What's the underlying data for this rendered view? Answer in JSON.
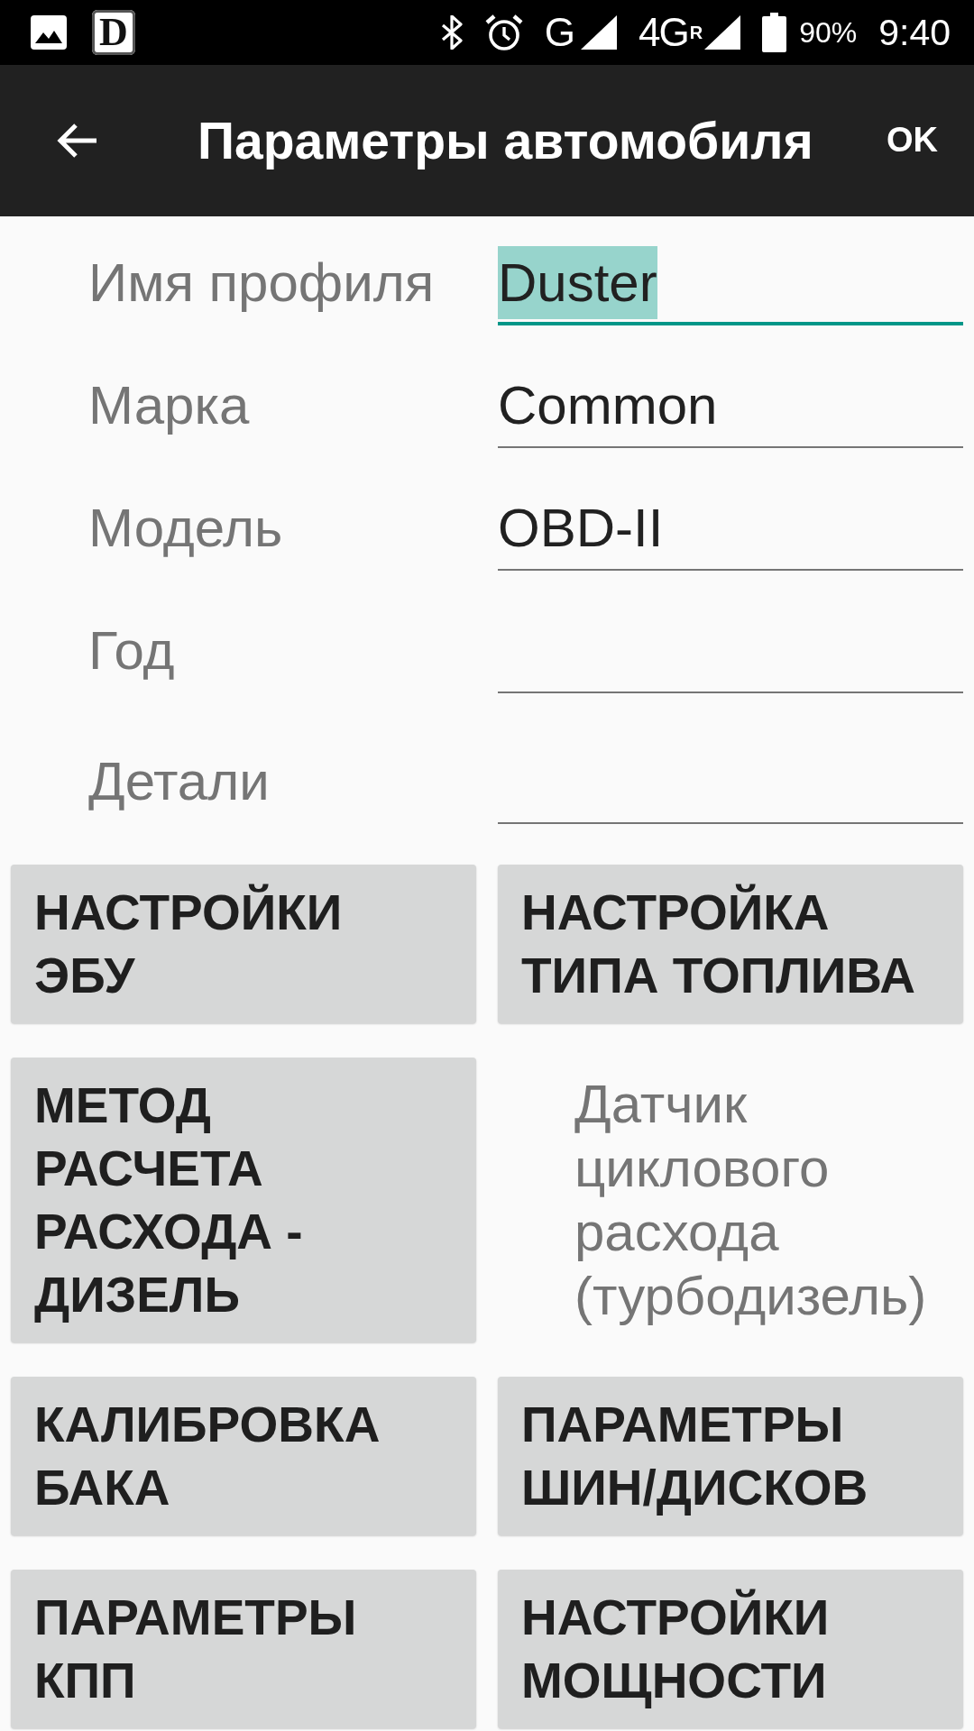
{
  "status_bar": {
    "notifications": [
      {
        "kind": "image"
      },
      {
        "kind": "letter",
        "text": "D"
      }
    ],
    "networks": [
      {
        "type": "G"
      },
      {
        "type": "4G",
        "roaming": "R"
      }
    ],
    "battery": "90%",
    "time": "9:40"
  },
  "app_bar": {
    "title": "Параметры автомобиля",
    "action": "OK"
  },
  "fields": [
    {
      "label": "Имя профиля",
      "value": "Duster",
      "focused": true,
      "text_selected": true
    },
    {
      "label": "Марка",
      "value": "Common",
      "focused": false,
      "text_selected": false
    },
    {
      "label": "Модель",
      "value": "OBD-II",
      "focused": false,
      "text_selected": false
    },
    {
      "label": "Год",
      "focused": false
    },
    {
      "label": "Детали",
      "focused": false
    }
  ],
  "settings": [
    {
      "kind": "button",
      "label": "НАСТРОЙКИ ЭБУ"
    },
    {
      "kind": "button",
      "label": "НАСТРОЙКА ТИПА ТОПЛИВА"
    },
    {
      "kind": "button",
      "label": "МЕТОД РАСЧЕТА РАСХОДА - ДИЗЕЛЬ"
    },
    {
      "kind": "text",
      "label": "Датчик циклового расхода (турбодизель)"
    },
    {
      "kind": "button",
      "label": "КАЛИБРОВКА БАКА"
    },
    {
      "kind": "button",
      "label": "ПАРАМЕТРЫ ШИН/ДИСКОВ"
    },
    {
      "kind": "button",
      "label": "ПАРАМЕТРЫ КПП"
    },
    {
      "kind": "button",
      "label": "НАСТРОЙКИ МОЩНОСТИ"
    }
  ]
}
